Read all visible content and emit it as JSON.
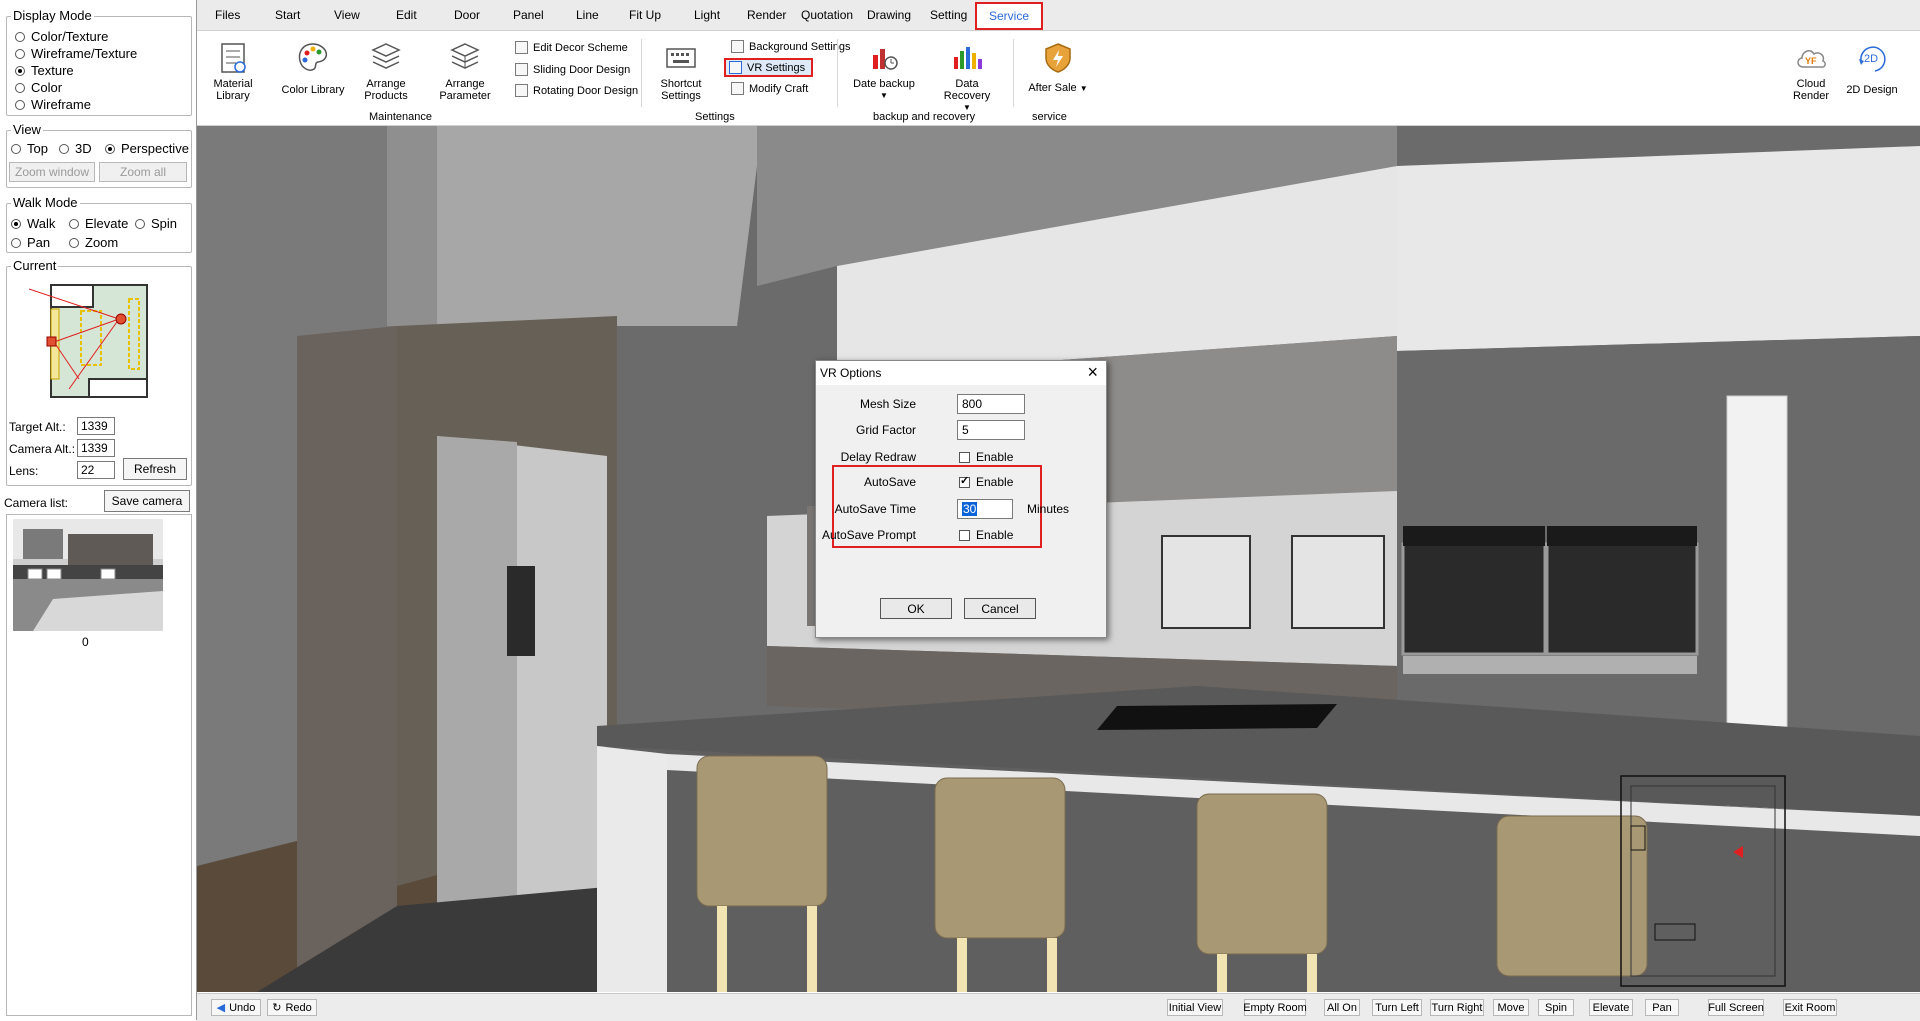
{
  "left_panel": {
    "display_mode": {
      "title": "Display Mode",
      "options": [
        "Color/Texture",
        "Wireframe/Texture",
        "Texture",
        "Color",
        "Wireframe"
      ],
      "selected": "Texture"
    },
    "view": {
      "title": "View",
      "options": [
        "Top",
        "3D",
        "Perspective"
      ],
      "selected": "Perspective",
      "zoom_window": "Zoom window",
      "zoom_all": "Zoom all"
    },
    "walk_mode": {
      "title": "Walk Mode",
      "options": [
        "Walk",
        "Elevate",
        "Spin",
        "Pan",
        "Zoom"
      ],
      "selected": "Walk"
    },
    "current": {
      "title": "Current",
      "target_alt_label": "Target Alt.:",
      "target_alt_value": "1339",
      "camera_alt_label": "Camera Alt.:",
      "camera_alt_value": "1339",
      "lens_label": "Lens:",
      "lens_value": "22",
      "refresh": "Refresh"
    },
    "camera_list": {
      "label": "Camera list:",
      "save_camera": "Save camera",
      "thumb_caption": "0"
    }
  },
  "menu": {
    "items": [
      "Files",
      "Start",
      "View",
      "Edit",
      "Door",
      "Panel",
      "Line",
      "Fit Up",
      "Light",
      "Render",
      "Quotation",
      "Drawing",
      "Setting",
      "Service"
    ],
    "active": "Service"
  },
  "ribbon": {
    "maintenance": {
      "label": "Maintenance",
      "material_library": [
        "Material",
        "Library"
      ],
      "color_library": "Color Library",
      "arrange_products": [
        "Arrange",
        "Products"
      ],
      "arrange_parameter": [
        "Arrange",
        "Parameter"
      ],
      "edit_decor_scheme": "Edit Decor Scheme",
      "sliding_door_design": "Sliding Door Design",
      "rotating_door_design": "Rotating Door Design"
    },
    "settings": {
      "label": "Settings",
      "shortcut_settings": [
        "Shortcut",
        "Settings"
      ],
      "background_settings": "Background Settings",
      "vr_settings": "VR Settings",
      "modify_craft": "Modify Craft"
    },
    "backup": {
      "label": "backup and recovery",
      "date_backup": "Date backup",
      "data_recovery": "Data Recovery"
    },
    "service": {
      "label": "service",
      "after_sale": "After Sale"
    },
    "right": {
      "cloud_render": [
        "Cloud",
        "Render"
      ],
      "cloud_badge": "YF",
      "design_2d": "2D Design",
      "design_2d_badge": "2D"
    }
  },
  "dialog": {
    "title": "VR Options",
    "mesh_size_label": "Mesh Size",
    "mesh_size_value": "800",
    "grid_factor_label": "Grid Factor",
    "grid_factor_value": "5",
    "delay_redraw_label": "Delay Redraw",
    "delay_redraw_enabled": false,
    "autosave_label": "AutoSave",
    "autosave_enabled": true,
    "autosave_time_label": "AutoSave Time",
    "autosave_time_value": "30",
    "minutes": "Minutes",
    "autosave_prompt_label": "AutoSave Prompt",
    "autosave_prompt_enabled": false,
    "enable": "Enable",
    "ok": "OK",
    "cancel": "Cancel"
  },
  "status_bar": {
    "undo": "Undo",
    "redo": "Redo",
    "buttons": [
      "Initial View",
      "Empty Room",
      "All On",
      "Turn Left",
      "Turn Right",
      "Move",
      "Spin",
      "Elevate",
      "Pan",
      "Full Screen",
      "Exit Room"
    ]
  },
  "colors": {
    "highlight_red": "#e02020",
    "active_menu_blue": "#2b6ad9",
    "selection_blue": "#0a64d8"
  }
}
